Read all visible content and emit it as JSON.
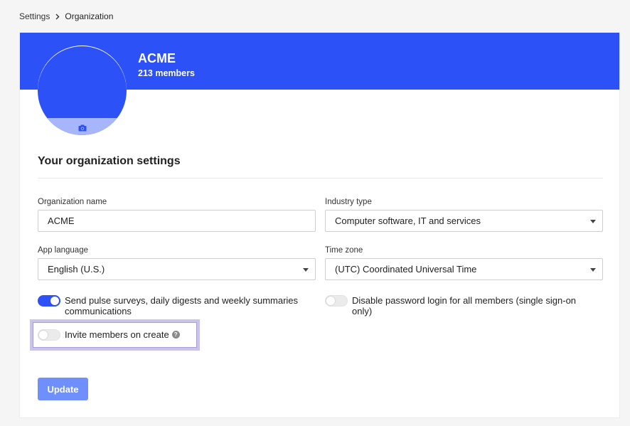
{
  "breadcrumb": {
    "root": "Settings",
    "current": "Organization"
  },
  "organization": {
    "name": "ACME",
    "members": "213 members"
  },
  "section": {
    "title": "Your organization settings"
  },
  "fields": {
    "org_name": {
      "label": "Organization name",
      "value": "ACME"
    },
    "industry": {
      "label": "Industry type",
      "value": "Computer software, IT and services"
    },
    "language": {
      "label": "App language",
      "value": "English (U.S.)"
    },
    "timezone": {
      "label": "Time zone",
      "value": "(UTC) Coordinated Universal Time"
    }
  },
  "toggles": {
    "pulse": {
      "label": "Send pulse surveys, daily digests and weekly summaries communications",
      "on": true
    },
    "disable_password": {
      "label": "Disable password login for all members (single sign-on only)",
      "on": false
    },
    "invite": {
      "label": "Invite members on create",
      "on": false
    }
  },
  "help_icon": "?",
  "update_label": "Update",
  "colors": {
    "brand": "#2c51f6",
    "button": "#6f8ffa",
    "highlight": "#cbc4ea"
  }
}
